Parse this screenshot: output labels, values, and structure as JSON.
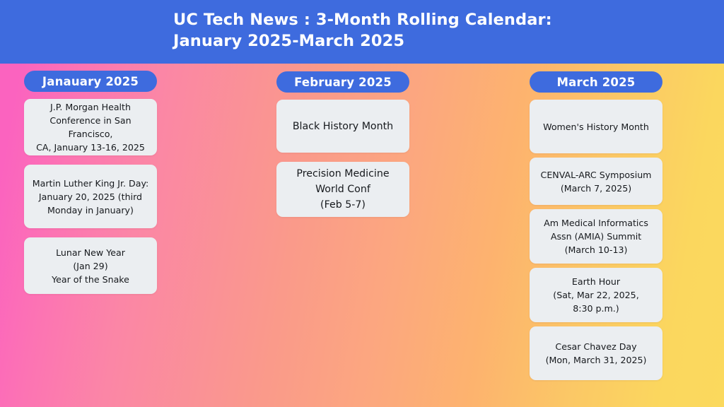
{
  "banner": {
    "title": "UC Tech News : 3-Month Rolling Calendar:\nJanuary 2025-March 2025",
    "background_color": "#3e6bde",
    "text_color": "#ffffff"
  },
  "theme": {
    "gradient_start_color": "#fb63bf",
    "gradient_mid_color": "#fa9a8a",
    "gradient_end_color": "#fbd75e",
    "pill_color": "#3e6bde",
    "card_color": "#ebeef1",
    "card_text_color": "#16191d"
  },
  "columns": [
    {
      "key": "january",
      "month_label": "Janauary 2025",
      "events": [
        {
          "text": "J.P. Morgan Health\nConference in San Francisco,\nCA, January 13-16, 2025"
        },
        {
          "text": "Martin Luther King Jr. Day:\nJanuary 20, 2025 (third\nMonday in January)"
        },
        {
          "text": "Lunar New Year\n(Jan 29)\nYear of the Snake"
        }
      ]
    },
    {
      "key": "february",
      "month_label": "February 2025",
      "events": [
        {
          "text": "Black History Month"
        },
        {
          "text": "Precision Medicine\nWorld Conf\n(Feb 5-7)"
        }
      ]
    },
    {
      "key": "march",
      "month_label": "March 2025",
      "events": [
        {
          "text": "Women's History Month"
        },
        {
          "text": "CENVAL-ARC Symposium\n(March 7, 2025)"
        },
        {
          "text": "Am Medical Informatics\nAssn (AMIA) Summit\n(March 10-13)"
        },
        {
          "text": "Earth Hour\n(Sat, Mar 22, 2025,\n8:30 p.m.)"
        },
        {
          "text": "Cesar Chavez Day\n(Mon, March 31, 2025)"
        }
      ]
    }
  ]
}
